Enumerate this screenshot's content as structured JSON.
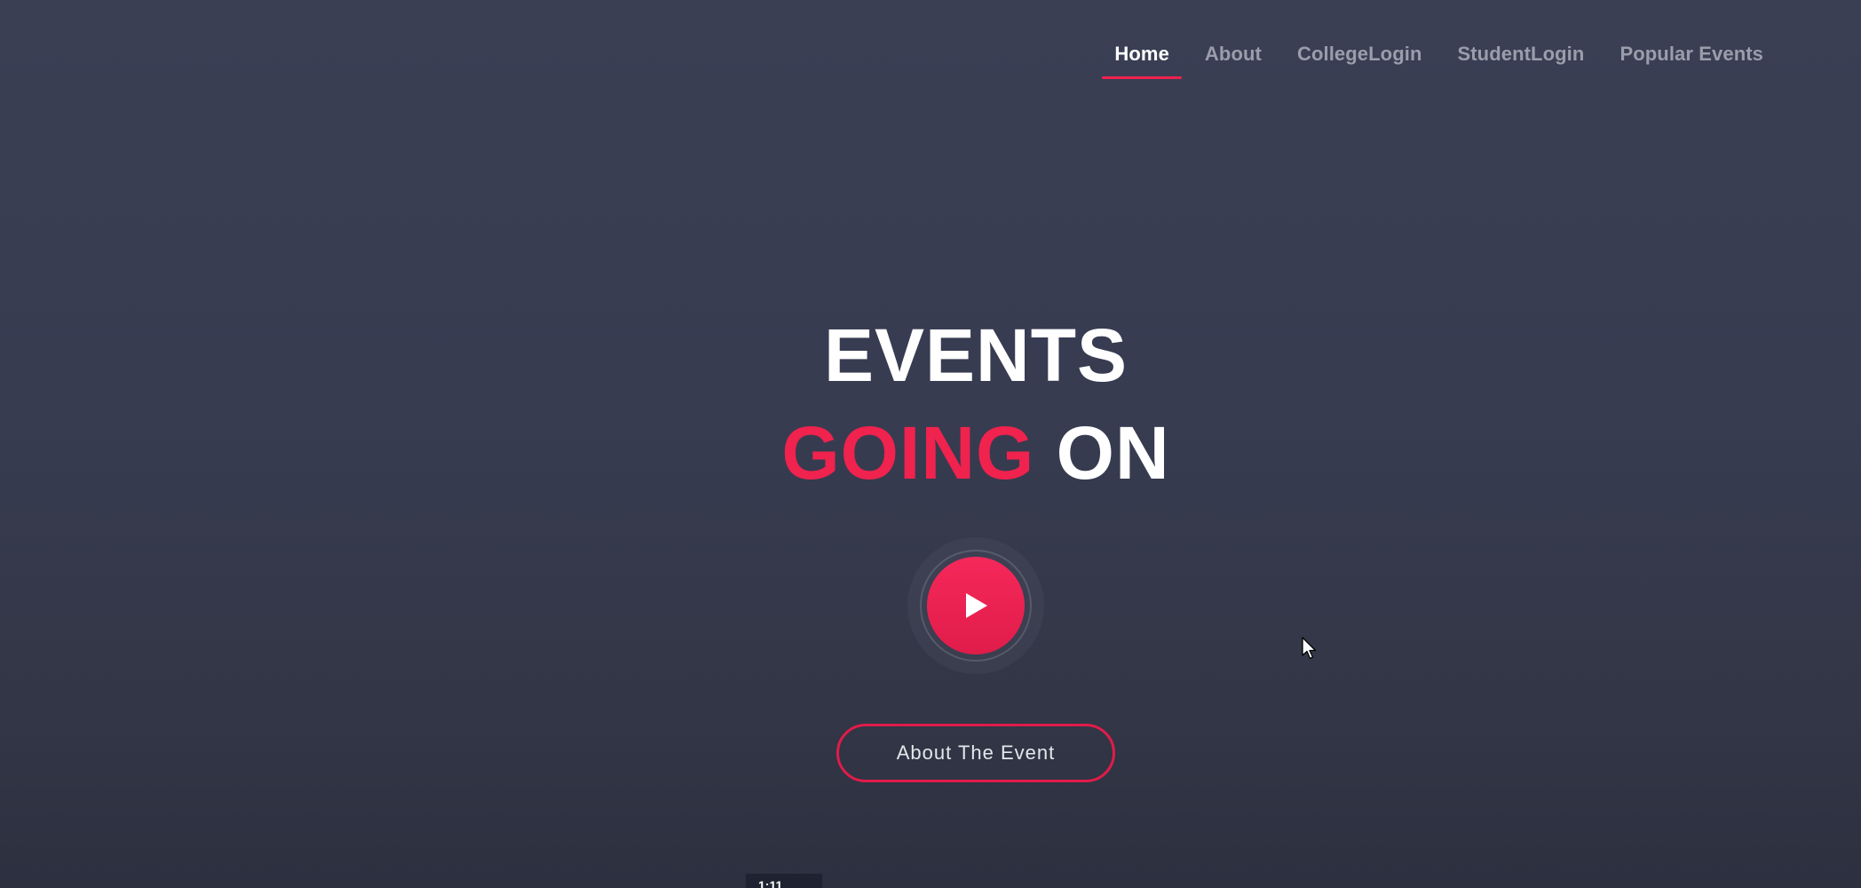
{
  "nav": {
    "items": [
      {
        "label": "Home",
        "active": true
      },
      {
        "label": "About",
        "active": false
      },
      {
        "label": "CollegeLogin",
        "active": false
      },
      {
        "label": "StudentLogin",
        "active": false
      },
      {
        "label": "Popular Events",
        "active": false
      }
    ]
  },
  "hero": {
    "line1": "EVENTS",
    "line2_accent": "GOING",
    "line2_rest": "ON",
    "play_icon": "play-icon",
    "cta_label": "About The Event"
  },
  "bottom_tab": {
    "text": "1:11"
  },
  "colors": {
    "accent": "#f0224e",
    "background": "#383c51",
    "nav_inactive": "#9b9dab",
    "text": "#ffffff"
  }
}
